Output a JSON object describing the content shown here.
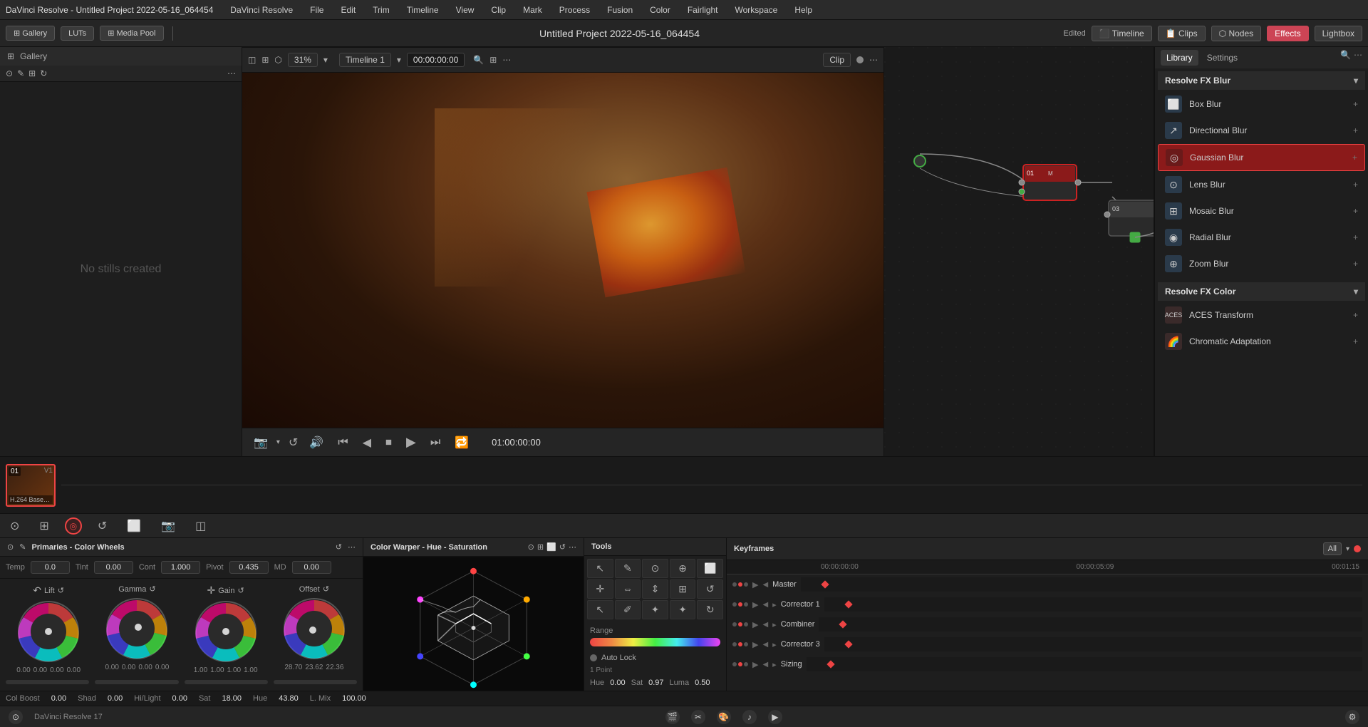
{
  "window": {
    "title": "DaVinci Resolve - Untitled Project 2022-05-16_064454"
  },
  "menu": {
    "items": [
      "DaVinci Resolve",
      "File",
      "Edit",
      "Trim",
      "Timeline",
      "View",
      "Clip",
      "Mark",
      "View",
      "Process",
      "Fusion",
      "Color",
      "Fairlight",
      "Workspace",
      "Help"
    ]
  },
  "toolbar2": {
    "project_title": "Untitled Project 2022-05-16_064454",
    "edited": "Edited",
    "zoom": "31%",
    "timeline_label": "Timeline 1",
    "timecode": "00:00:00:00",
    "clip_label": "Clip",
    "nav_buttons": [
      "Timeline",
      "Clips",
      "Nodes",
      "Effects",
      "Lightbox"
    ]
  },
  "left_panel": {
    "no_stills_text": "No stills created"
  },
  "video": {
    "timecode": "01:00:00:00"
  },
  "right_panel": {
    "tabs": [
      "Library",
      "Settings"
    ],
    "sections": {
      "resolve_fx_blur": {
        "title": "Resolve FX Blur",
        "items": [
          {
            "name": "Box Blur"
          },
          {
            "name": "Directional Blur"
          },
          {
            "name": "Gaussian Blur",
            "selected": true
          },
          {
            "name": "Lens Blur"
          },
          {
            "name": "Mosaic Blur"
          },
          {
            "name": "Radial Blur"
          },
          {
            "name": "Zoom Blur"
          }
        ]
      },
      "resolve_fx_color": {
        "title": "Resolve FX Color",
        "items": [
          {
            "name": "ACES Transform"
          },
          {
            "name": "Chromatic Adaptation"
          }
        ]
      }
    }
  },
  "color_wheels": {
    "title": "Primaries - Color Wheels",
    "temp_label": "Temp",
    "temp_value": "0.0",
    "tint_label": "Tint",
    "tint_value": "0.00",
    "cont_label": "Cont",
    "cont_value": "1.000",
    "pivot_label": "Pivot",
    "pivot_value": "0.435",
    "md_label": "MD",
    "md_value": "0.00",
    "wheels": [
      {
        "label": "Lift",
        "values": [
          "0.00",
          "0.00",
          "0.00",
          "0.00"
        ]
      },
      {
        "label": "Gamma",
        "values": [
          "0.00",
          "0.00",
          "0.00",
          "0.00"
        ]
      },
      {
        "label": "Gain",
        "values": [
          "1.00",
          "1.00",
          "1.00",
          "1.00"
        ]
      },
      {
        "label": "Offset",
        "values": [
          "28.70",
          "23.62",
          "22.36"
        ]
      }
    ],
    "col_boost_label": "Col Boost",
    "col_boost_value": "0.00",
    "shad_label": "Shad",
    "shad_value": "0.00",
    "hilight_label": "Hi/Light",
    "hilight_value": "0.00",
    "sat_label": "Sat",
    "sat_value": "18.00",
    "hue_label": "Hue",
    "hue_value": "43.80",
    "lmix_label": "L. Mix",
    "lmix_value": "100.00"
  },
  "color_warper": {
    "title": "Color Warper - Hue - Saturation"
  },
  "tools": {
    "title": "Tools",
    "range_label": "Range",
    "auto_lock_label": "Auto Lock",
    "point_label": "1 Point",
    "hue_label": "Hue",
    "hue_value": "0.00",
    "sat_label": "Sat",
    "sat_value": "0.97",
    "luma_label": "Luma",
    "luma_value": "0.50"
  },
  "keyframes": {
    "title": "Keyframes",
    "all_label": "All",
    "timecodes": [
      "00:00:00:00",
      "00:00:05:09",
      "00:01:15"
    ],
    "master_label": "Master",
    "items": [
      {
        "name": "Corrector 1"
      },
      {
        "name": "Combiner"
      },
      {
        "name": "Corrector 3"
      },
      {
        "name": "Sizing"
      }
    ]
  },
  "status_bar": {
    "col_boost_label": "Col Boost",
    "col_boost_value": "0.00",
    "shad_label": "Shad",
    "shad_value": "0.00",
    "hilight_label": "Hi/Light",
    "hilight_value": "0.00",
    "sat_label": "Sat",
    "sat_value": "18.00",
    "hue_label": "Hue",
    "hue_value": "43.80",
    "lmix_label": "L. Mix",
    "lmix_value": "100.00"
  },
  "bottom_app_bar": {
    "app_label": "DaVinci Resolve 17"
  },
  "icons": {
    "play": "▶",
    "pause": "⏸",
    "stop": "⏹",
    "prev": "⏮",
    "next": "⏭",
    "back_frame": "◀",
    "fwd_frame": "▶",
    "loop": "🔁",
    "volume": "🔊",
    "expand": "⬜",
    "chevron_down": "▾",
    "chevron_right": "▸",
    "plus": "+",
    "close": "✕",
    "gear": "⚙",
    "search": "🔍",
    "grid": "⊞",
    "chain": "🔗",
    "color_picker": "⊙"
  }
}
